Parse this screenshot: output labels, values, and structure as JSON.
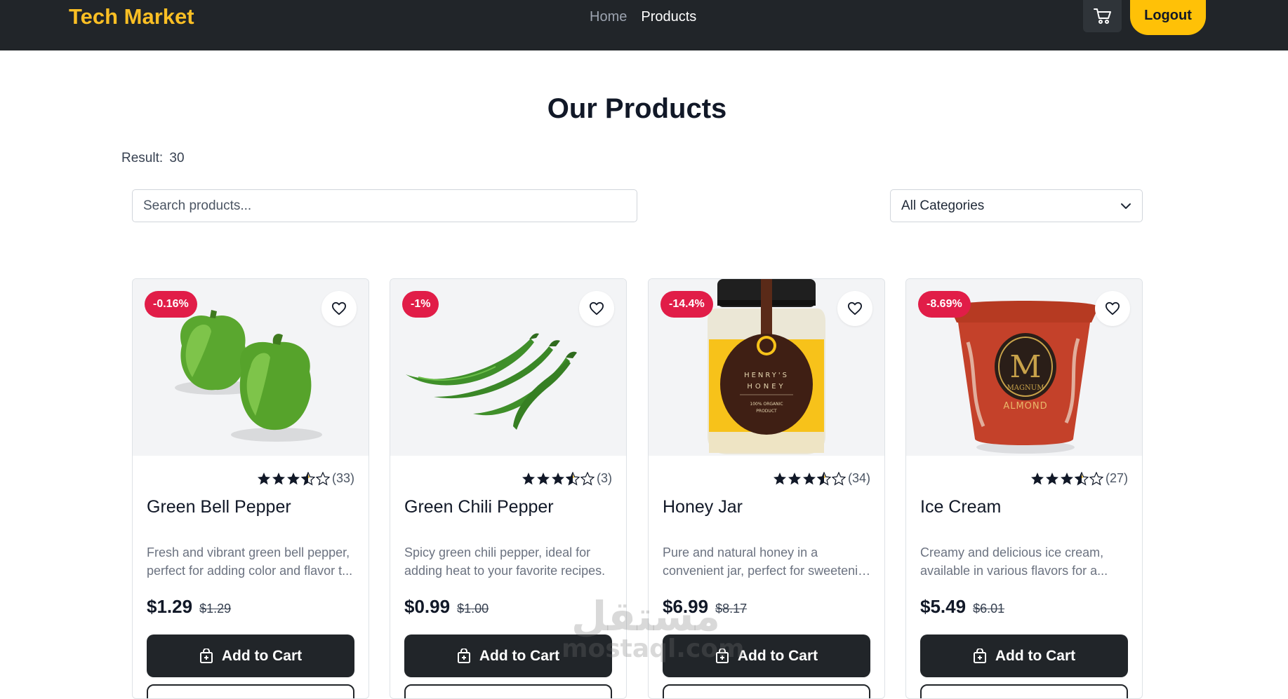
{
  "header": {
    "brand": "Tech Market",
    "nav": [
      {
        "label": "Home",
        "active": false
      },
      {
        "label": "Products",
        "active": true
      }
    ],
    "cart_icon": "cart-icon",
    "logout_label": "Logout"
  },
  "colors": {
    "navbar_bg": "#212529",
    "accent": "#ffc107",
    "brand": "#fbbf24",
    "discount_badge": "#e11d48",
    "button_dark": "#212529"
  },
  "main": {
    "title": "Our Products",
    "result_label": "Result:",
    "result_count": "30",
    "search": {
      "placeholder": "Search products...",
      "value": ""
    },
    "category_select": {
      "selected": "All Categories"
    }
  },
  "products": [
    {
      "discount": "-0.16%",
      "rating_stars": 3.5,
      "reviews": "(33)",
      "name": "Green Bell Pepper",
      "desc_line1": "Fresh and vibrant green bell pepper,",
      "desc_line2": "perfect for adding color and flavor t...",
      "price": "$1.29",
      "old_price": "$1.29",
      "add_label": "Add to Cart",
      "image_icon": "bell-pepper-image"
    },
    {
      "discount": "-1%",
      "rating_stars": 3.5,
      "reviews": "(3)",
      "name": "Green Chili Pepper",
      "desc_line1": "Spicy green chili pepper, ideal for",
      "desc_line2": "adding heat to your favorite recipes.",
      "price": "$0.99",
      "old_price": "$1.00",
      "add_label": "Add to Cart",
      "image_icon": "chili-pepper-image"
    },
    {
      "discount": "-14.4%",
      "rating_stars": 3.5,
      "reviews": "(34)",
      "name": "Honey Jar",
      "desc_line1": "Pure and natural honey in a",
      "desc_line2": "convenient jar, perfect for sweetenin...",
      "price": "$6.99",
      "old_price": "$8.17",
      "add_label": "Add to Cart",
      "image_icon": "honey-jar-image",
      "jar_label_1": "HENRY'S",
      "jar_label_2": "HONEY",
      "jar_label_3": "100% ORGANIC",
      "jar_label_4": "PRODUCT"
    },
    {
      "discount": "-8.69%",
      "rating_stars": 3.5,
      "reviews": "(27)",
      "name": "Ice Cream",
      "desc_line1": "Creamy and delicious ice cream,",
      "desc_line2": "available in various flavors for a...",
      "price": "$5.49",
      "old_price": "$6.01",
      "add_label": "Add to Cart",
      "image_icon": "ice-cream-image",
      "tub_letter": "M",
      "tub_brand": "MAGNUM",
      "tub_flavor": "ALMOND"
    }
  ],
  "watermark": {
    "arabic": "مستقل",
    "latin": "mostaql.com"
  }
}
